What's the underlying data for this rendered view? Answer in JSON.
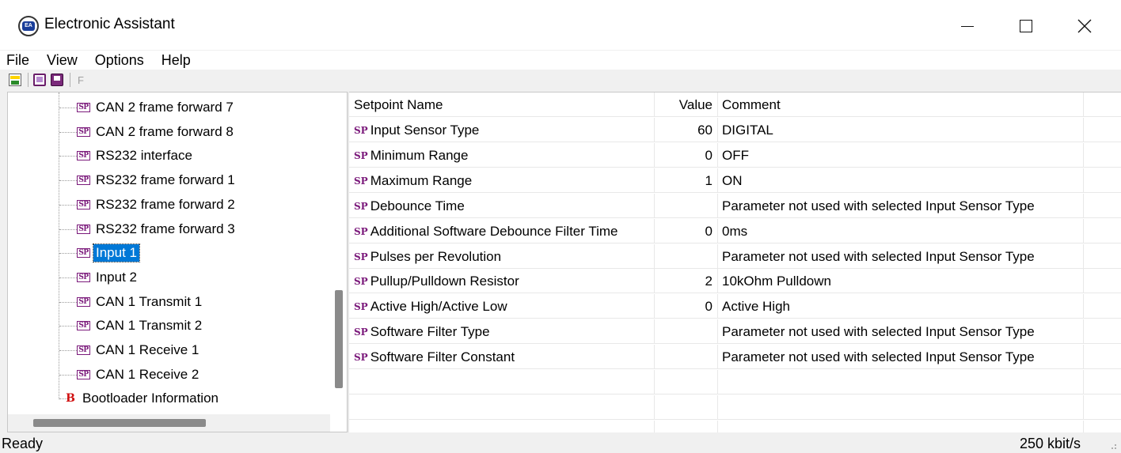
{
  "window": {
    "title": "Electronic Assistant",
    "app_icon": "ea-logo-icon"
  },
  "menu": [
    "File",
    "View",
    "Options",
    "Help"
  ],
  "toolbar": {
    "buttons": [
      "can-connect-icon",
      "setpoint-read-icon",
      "setpoint-write-icon"
    ],
    "f_label": "F"
  },
  "tree": {
    "items": [
      {
        "icon": "SP",
        "label": "CAN 2 frame forward 7"
      },
      {
        "icon": "SP",
        "label": "CAN 2 frame forward 8"
      },
      {
        "icon": "SP",
        "label": "RS232 interface"
      },
      {
        "icon": "SP",
        "label": "RS232 frame forward 1"
      },
      {
        "icon": "SP",
        "label": "RS232 frame forward 2"
      },
      {
        "icon": "SP",
        "label": "RS232 frame forward 3"
      },
      {
        "icon": "SP",
        "label": "Input 1",
        "selected": true
      },
      {
        "icon": "SP",
        "label": "Input 2"
      },
      {
        "icon": "SP",
        "label": "CAN 1 Transmit 1"
      },
      {
        "icon": "SP",
        "label": "CAN 1 Transmit 2"
      },
      {
        "icon": "SP",
        "label": "CAN 1 Receive 1"
      },
      {
        "icon": "SP",
        "label": "CAN 1 Receive 2"
      }
    ],
    "bootloader": {
      "icon": "B",
      "label": "Bootloader Information"
    }
  },
  "grid": {
    "headers": {
      "name": "Setpoint Name",
      "value": "Value",
      "comment": "Comment"
    },
    "sp_mark": "SP",
    "rows": [
      {
        "name": "Input Sensor Type",
        "value": "60",
        "comment": "DIGITAL"
      },
      {
        "name": "Minimum Range",
        "value": "0",
        "comment": "OFF"
      },
      {
        "name": "Maximum Range",
        "value": "1",
        "comment": "ON"
      },
      {
        "name": "Debounce Time",
        "value": "",
        "comment": "Parameter not used with selected Input Sensor Type"
      },
      {
        "name": "Additional Software Debounce Filter Time",
        "value": "0",
        "comment": "0ms"
      },
      {
        "name": "Pulses per Revolution",
        "value": "",
        "comment": "Parameter not used with selected Input Sensor Type"
      },
      {
        "name": "Pullup/Pulldown Resistor",
        "value": "2",
        "comment": "10kOhm Pulldown"
      },
      {
        "name": "Active High/Active Low",
        "value": "0",
        "comment": "Active High"
      },
      {
        "name": "Software Filter Type",
        "value": "",
        "comment": "Parameter not used with selected Input Sensor Type"
      },
      {
        "name": "Software Filter Constant",
        "value": "",
        "comment": "Parameter not used with selected Input Sensor Type"
      }
    ]
  },
  "status": {
    "left": "Ready",
    "right": "250 kbit/s"
  },
  "colors": {
    "selection": "#0078d7",
    "sp_icon": "#7b1a7b",
    "bootloader_icon": "#d01010"
  }
}
